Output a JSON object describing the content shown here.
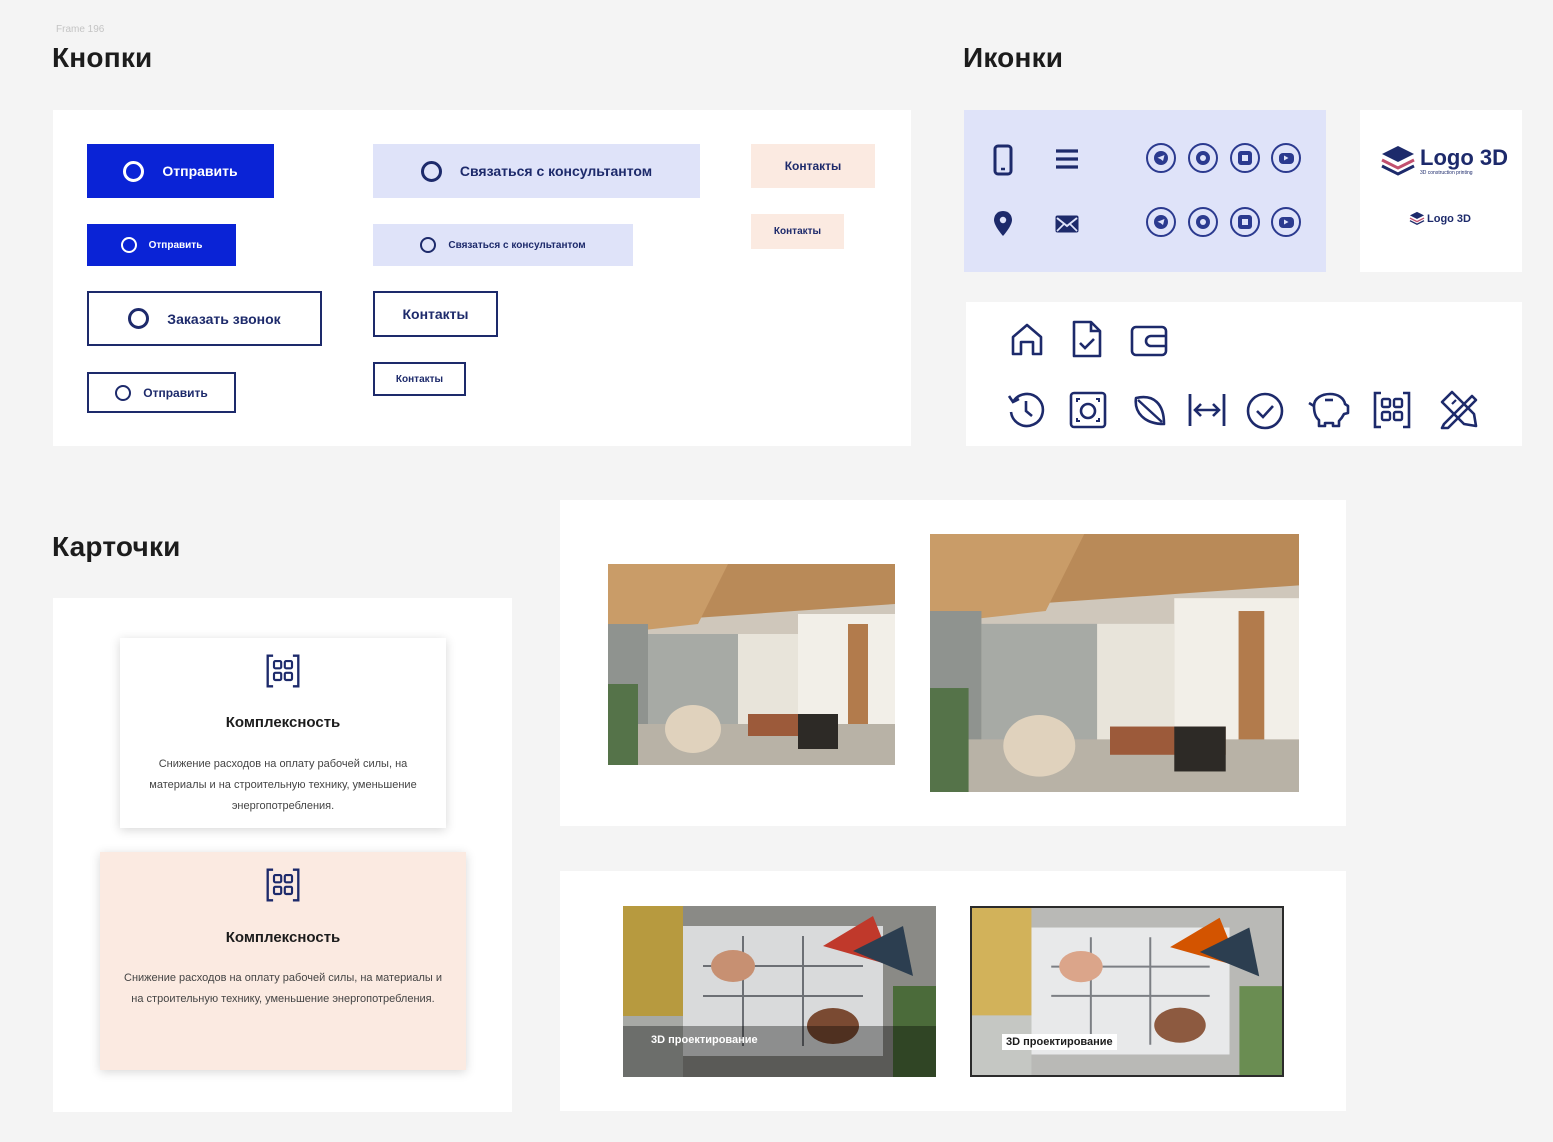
{
  "frame_label": "Frame 196",
  "sections": {
    "buttons_title": "Кнопки",
    "icons_title": "Иконки",
    "cards_title": "Карточки"
  },
  "buttons": {
    "send_primary_large": "Отправить",
    "send_primary_small": "Отправить",
    "order_call_outline": "Заказать звонок",
    "send_outline_small": "Отправить",
    "consultant_light_large": "Связаться с консультантом",
    "consultant_light_small": "Связаться с консультантом",
    "contacts_outline_large": "Контакты",
    "contacts_outline_small": "Контакты",
    "contacts_peach_large": "Контакты",
    "contacts_peach_small": "Контакты"
  },
  "logo": {
    "text": "Logo 3D",
    "subtitle": "3D construction printing",
    "text_small": "Logo 3D"
  },
  "icons": {
    "contact_row": [
      "phone-icon",
      "menu-icon",
      "map-pin-icon",
      "mail-icon"
    ],
    "social": [
      "telegram-icon",
      "whatsapp-icon",
      "vk-icon",
      "youtube-icon"
    ],
    "outline_row1": [
      "home-icon",
      "document-check-icon",
      "wallet-icon"
    ],
    "outline_row2": [
      "history-icon",
      "scan-icon",
      "leaf-icon",
      "width-icon",
      "check-circle-icon",
      "piggy-bank-icon",
      "grid-icon",
      "tools-icon"
    ]
  },
  "cards": [
    {
      "title": "Комплексность",
      "text": "Снижение расходов на оплату рабочей силы, на материалы и на строительную технику, уменьшение энергопотребления.",
      "icon": "grid-icon"
    },
    {
      "title": "Комплексность",
      "text": "Снижение расходов на оплату рабочей силы, на материалы и на строительную технику, уменьшение энергопотребления.",
      "icon": "grid-icon"
    }
  ],
  "photos": {
    "caption_1": "3D проектирование",
    "caption_2": "3D проектирование"
  },
  "colors": {
    "primary": "#0a23d6",
    "navy": "#1d2a6b",
    "light_blue": "#dfe3f9",
    "peach": "#fbeae1",
    "background": "#f4f4f4"
  }
}
